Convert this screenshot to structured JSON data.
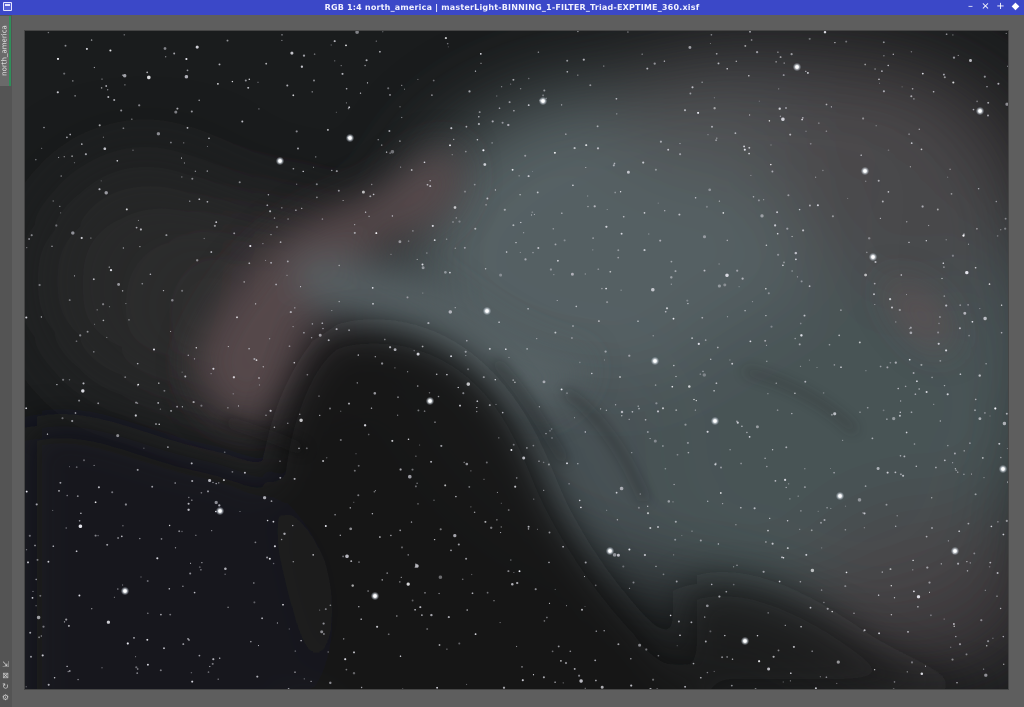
{
  "window": {
    "title": "RGB 1:4 north_america | masterLight-BINNING_1-FILTER_Triad-EXPTIME_360.xisf",
    "controls": {
      "minimize": "–",
      "shade": "×",
      "maximize": "+",
      "close": "◆"
    }
  },
  "sidebar": {
    "view_tab_label": "north_america",
    "icons": [
      "pin-icon",
      "close-view-icon",
      "refresh-icon",
      "settings-icon"
    ]
  },
  "image": {
    "subject": "north_america",
    "zoom": "1:4",
    "color_space": "RGB"
  },
  "colors": {
    "titlebar": "#3b48c8",
    "tab_accent": "#2f8f5a",
    "background": "#5e5e5e"
  }
}
